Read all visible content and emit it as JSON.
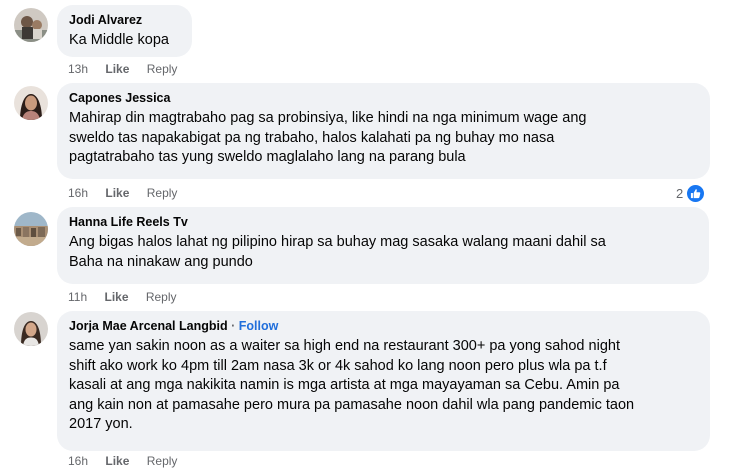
{
  "comments": [
    {
      "author": "Jodi Alvarez",
      "lines": [
        "Ka Middle kopa"
      ],
      "time": "13h",
      "like": "Like",
      "reply": "Reply"
    },
    {
      "author": "Capones Jessica",
      "lines": [
        "Mahirap din magtrabaho pag sa probinsiya, like hindi na nga minimum wage ang",
        "sweldo tas napakabigat pa ng trabaho, halos kalahati pa ng buhay mo nasa",
        "pagtatrabaho tas yung sweldo maglalaho lang na parang bula"
      ],
      "time": "16h",
      "like": "Like",
      "reply": "Reply",
      "reaction_count": "2",
      "reaction_icon": "thumbs-up-icon"
    },
    {
      "author": "Hanna Life Reels Tv",
      "lines": [
        "Ang bigas halos lahat ng pilipino hirap sa buhay mag sasaka walang maani dahil sa",
        "Baha na ninakaw ang pundo"
      ],
      "time": "11h",
      "like": "Like",
      "reply": "Reply"
    },
    {
      "author": "Jorja Mae Arcenal Langbid",
      "separator": "·",
      "follow": "Follow",
      "lines": [
        "same yan sakin noon as a waiter sa high end na restaurant 300+ pa yong sahod night",
        "shift ako work ko 4pm till 2am nasa 3k or 4k sahod ko lang noon pero plus wla pa t.f",
        "kasali at ang mga nakikita namin is mga artista at mga mayayaman sa Cebu. Amin pa",
        "ang kain non at pamasahe pero mura pa pamasahe noon dahil wla pang pandemic taon",
        "2017 yon."
      ],
      "time": "16h",
      "like": "Like",
      "reply": "Reply"
    }
  ],
  "colors": {
    "bubble": "#f0f2f5",
    "meta": "#65676b",
    "follow": "#216fdb",
    "like_badge": "#1877f2"
  }
}
